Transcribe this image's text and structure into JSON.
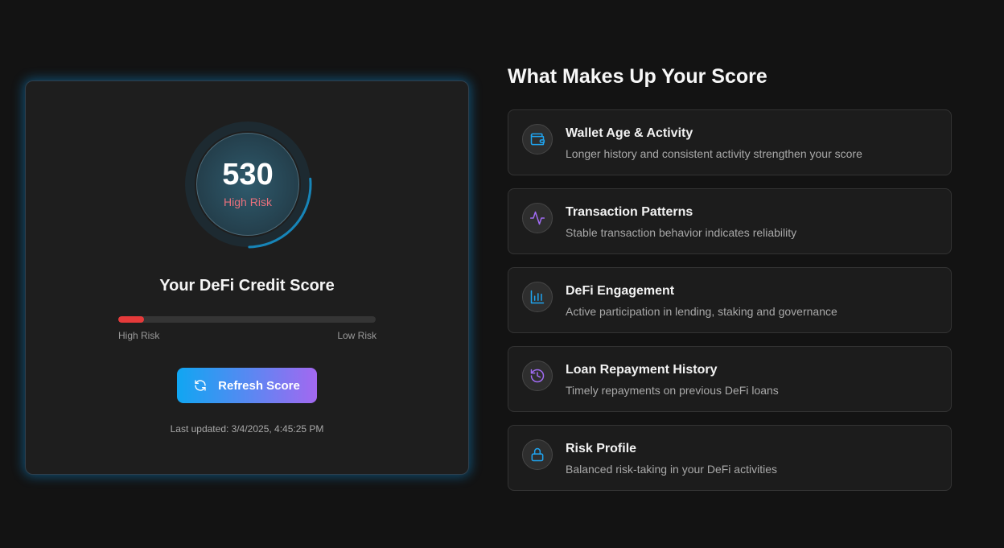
{
  "score_card": {
    "score": "530",
    "risk_label": "High Risk",
    "score_progress": 0.26,
    "title": "Your DeFi Credit Score",
    "risk_bar_fill": 0.1,
    "risk_bar_high_label": "High Risk",
    "risk_bar_low_label": "Low Risk",
    "refresh_label": "Refresh Score",
    "last_updated": "Last updated: 3/4/2025, 4:45:25 PM"
  },
  "factors_section": {
    "title": "What Makes Up Your Score",
    "factors": [
      {
        "title": "Wallet Age & Activity",
        "description": "Longer history and consistent activity strengthen your score",
        "icon": "wallet-icon",
        "color": "#1fa4f0"
      },
      {
        "title": "Transaction Patterns",
        "description": "Stable transaction behavior indicates reliability",
        "icon": "activity-icon",
        "color": "#a06bf3"
      },
      {
        "title": "DeFi Engagement",
        "description": "Active participation in lending, staking and governance",
        "icon": "bar-chart-icon",
        "color": "#1fa4f0"
      },
      {
        "title": "Loan Repayment History",
        "description": "Timely repayments on previous DeFi loans",
        "icon": "history-icon",
        "color": "#a06bf3"
      },
      {
        "title": "Risk Profile",
        "description": "Balanced risk-taking in your DeFi activities",
        "icon": "lock-icon",
        "color": "#1fa4f0"
      }
    ]
  },
  "colors": {
    "background": "#131313",
    "card": "#1e1e1e",
    "accent_blue": "#10a6f2",
    "accent_purple": "#a368f0",
    "risk_red": "#e53a3a",
    "risk_text": "#e8707c"
  }
}
